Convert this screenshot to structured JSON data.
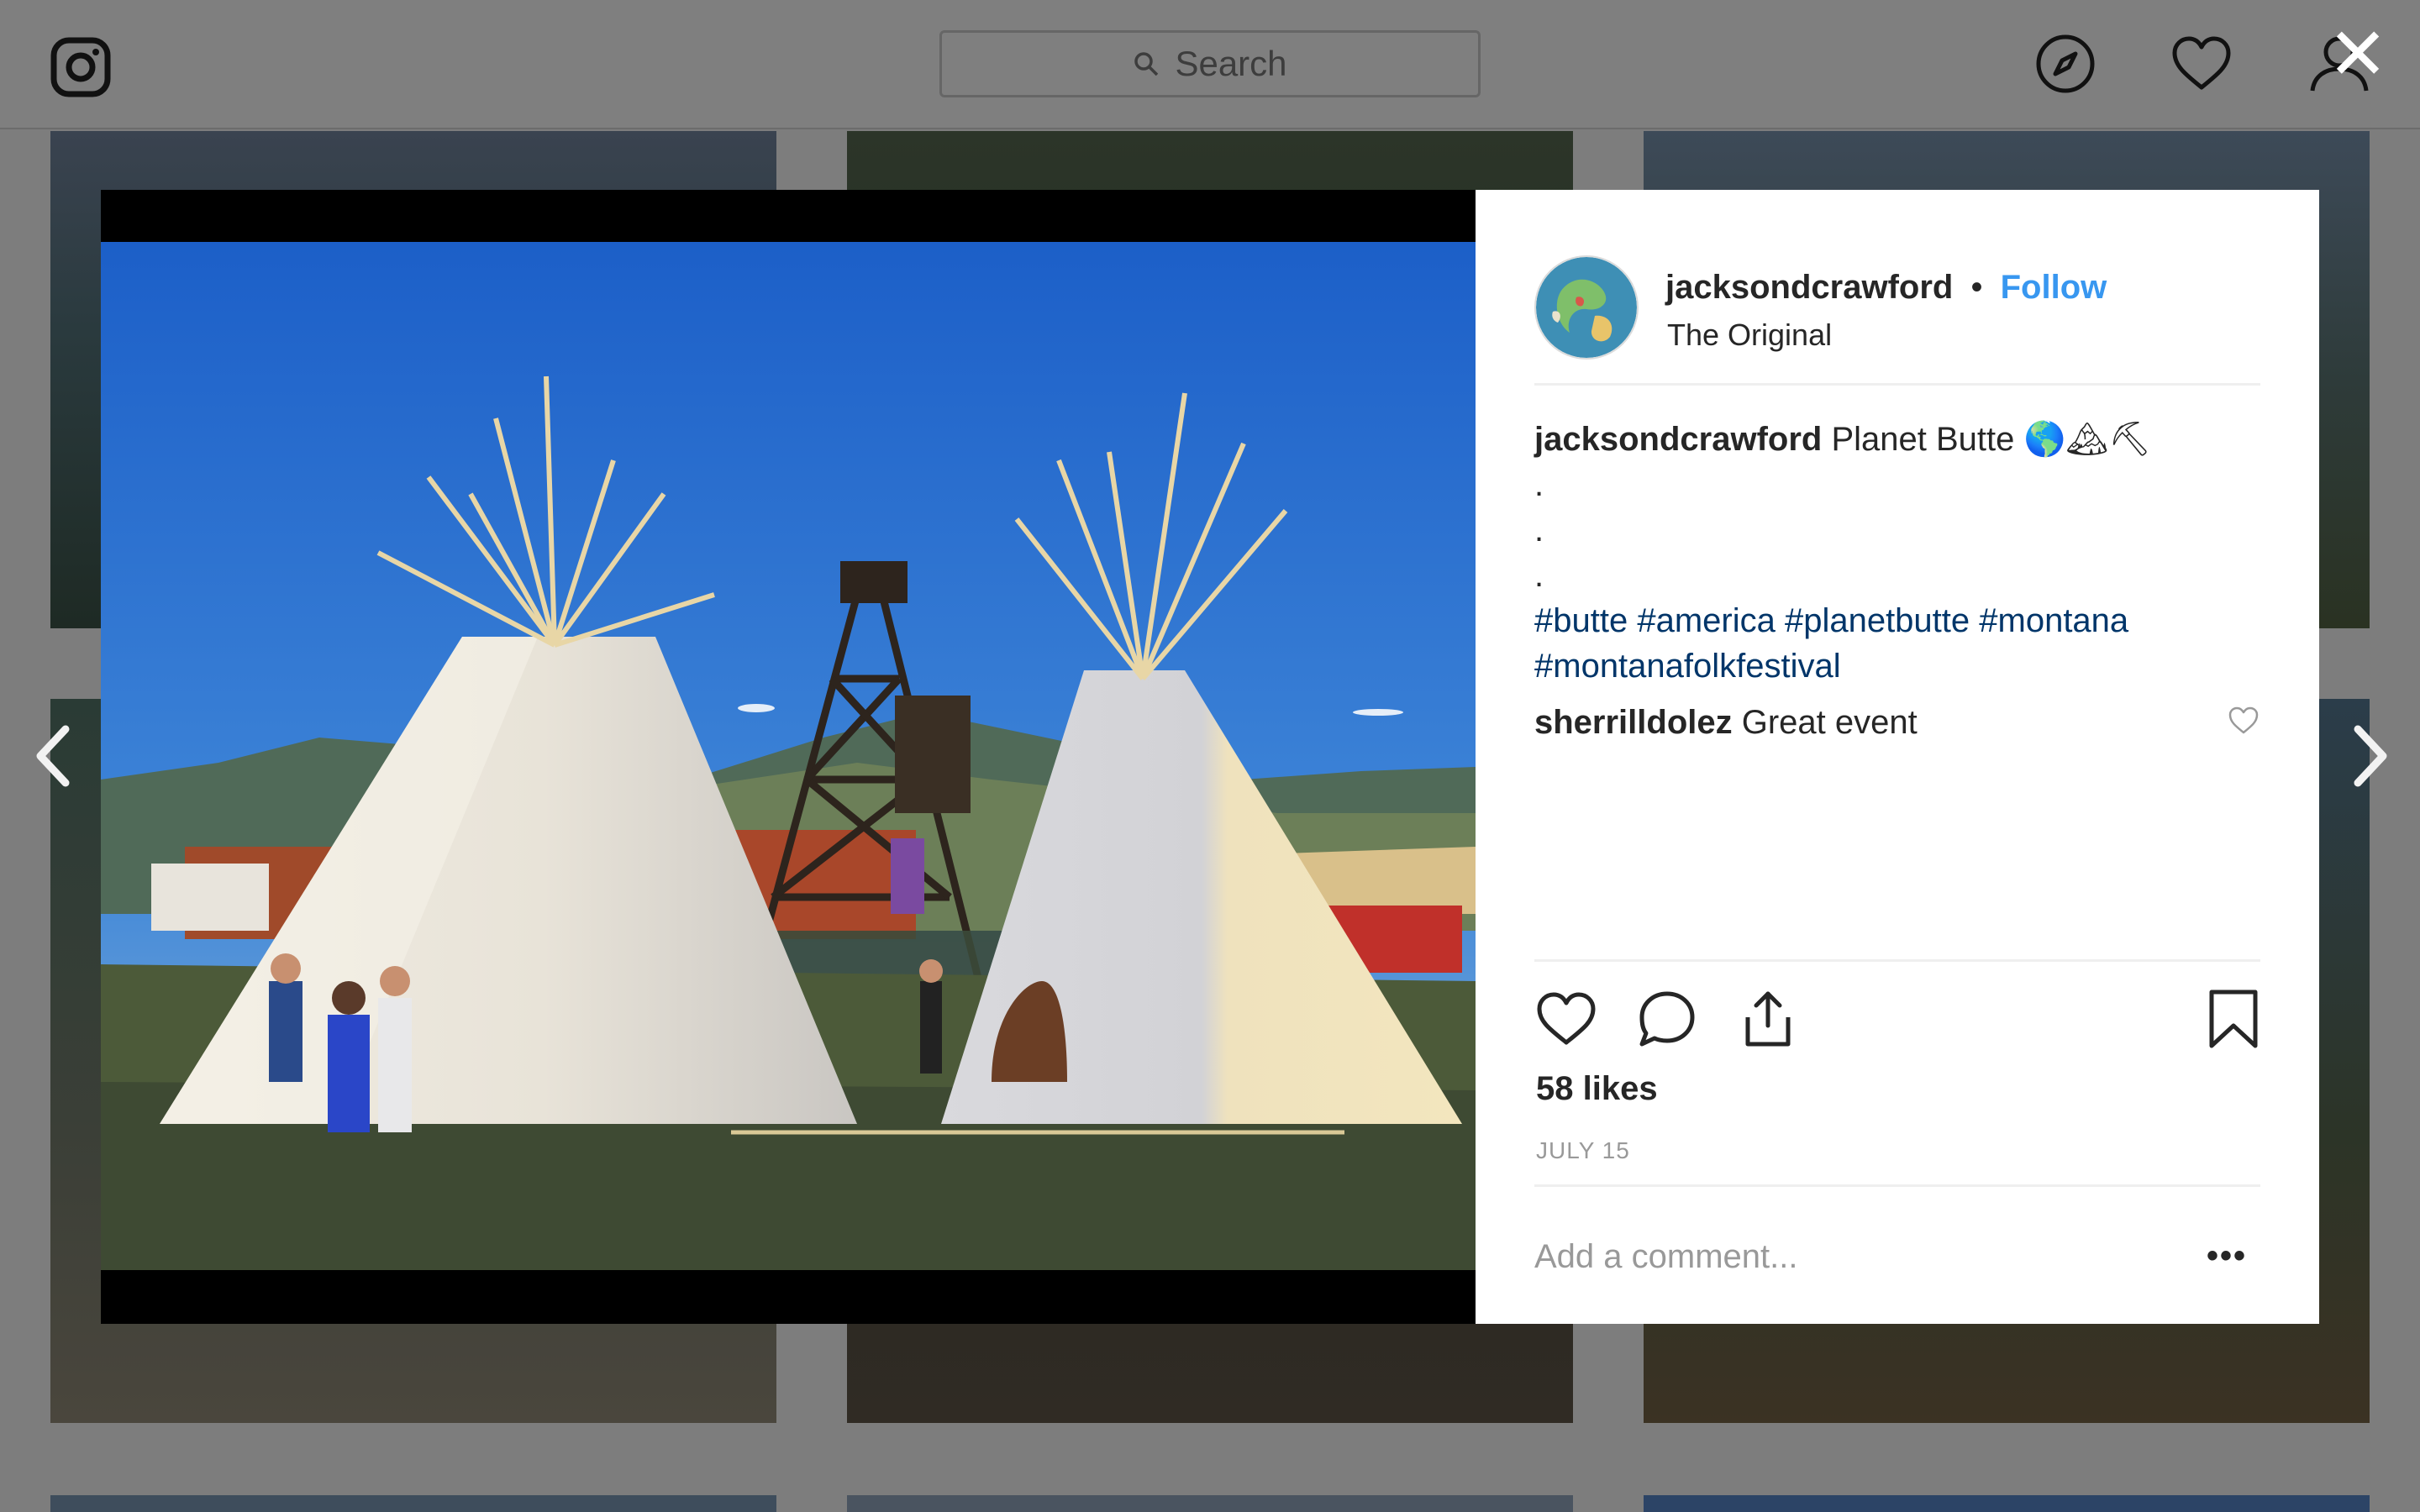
{
  "topbar": {
    "search_placeholder": "Search",
    "icons": [
      "instagram-logo-icon",
      "search-icon",
      "compass-icon",
      "heart-icon",
      "profile-icon"
    ]
  },
  "modal": {
    "close_icon": "close-icon",
    "prev_icon": "chevron-left-icon",
    "next_icon": "chevron-right-icon"
  },
  "post": {
    "username": "jacksondcrawford",
    "follow_label": "Follow",
    "separator": "•",
    "location": "The Original",
    "caption_text": "Planet Butte 🌎🏔⛏",
    "caption_dots": [
      ".",
      ".",
      "."
    ],
    "hashtags": "#butte #america #planetbutte #montana #montanafolkfestival",
    "comments": [
      {
        "username": "sherrilldolez",
        "text": "Great event"
      }
    ],
    "likes": "58 likes",
    "date": "JULY 15",
    "comment_placeholder": "Add a comment...",
    "more_label": "•••"
  },
  "colors": {
    "accent": "#3897f0",
    "hashtag": "#003569",
    "text": "#262626",
    "muted": "#999999"
  }
}
